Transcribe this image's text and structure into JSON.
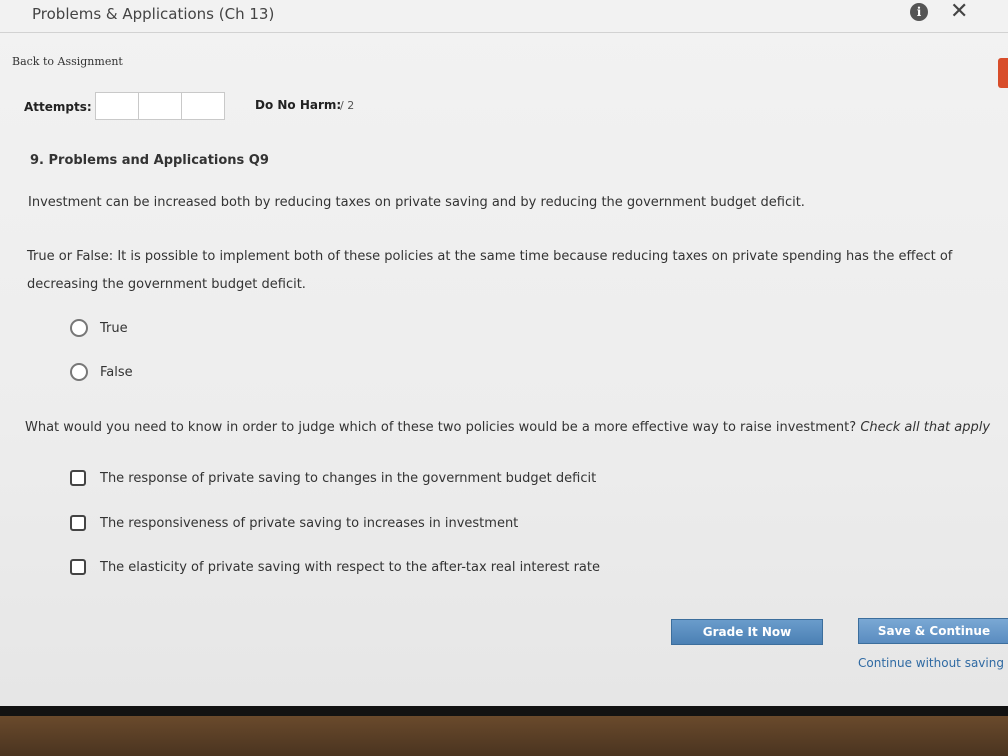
{
  "window": {
    "title": "Problems & Applications (Ch 13)",
    "info_icon": "info-icon",
    "close_icon": "close-icon",
    "info_glyph": "i",
    "close_glyph": "✕"
  },
  "nav": {
    "back_link": "Back to Assignment"
  },
  "status": {
    "attempts_label": "Attempts:",
    "attempt_boxes": [
      "",
      "",
      ""
    ],
    "do_no_harm_label": "Do No Harm:",
    "do_no_harm_value": "/ 2"
  },
  "question": {
    "title": "9. Problems and Applications Q9",
    "intro": "Investment can be increased both by reducing taxes on private saving and by reducing the government budget deficit.",
    "tf_prompt": "True or False: It is possible to implement both of these policies at the same time because reducing taxes on private spending has the effect of decreasing the government budget deficit.",
    "tf_options": [
      "True",
      "False"
    ],
    "q2_prompt": "What would you need to know in order to judge which of these two policies would be a more effective way to raise investment?",
    "q2_instruction": "Check all that apply",
    "q2_options": [
      "The response of private saving to changes in the government budget deficit",
      "The responsiveness of private saving to increases in investment",
      "The elasticity of private saving with respect to the after-tax real interest rate"
    ]
  },
  "actions": {
    "grade_button": "Grade It Now",
    "save_button": "Save & Continue",
    "continue_link": "Continue without saving"
  },
  "colors": {
    "button_blue": "#5a8cc0",
    "link_blue": "#2f6aa3"
  }
}
